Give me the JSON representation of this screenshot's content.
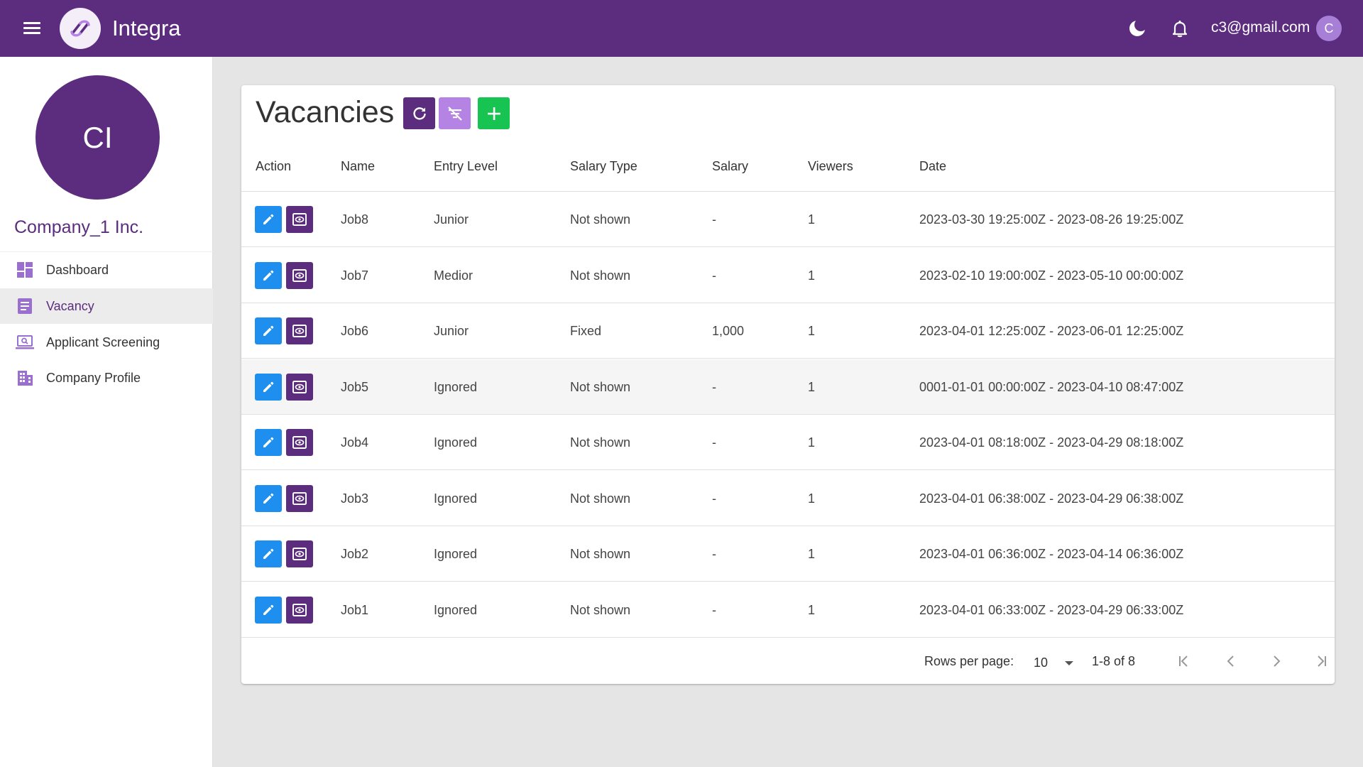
{
  "app": {
    "title": "Integra",
    "logo_icon": "integra-logo-icon",
    "accent": "#5c2d7e"
  },
  "topbar": {
    "user_email": "c3@gmail.com",
    "user_initial": "C"
  },
  "sidebar": {
    "avatar_initials": "CI",
    "company_name": "Company_1 Inc.",
    "items": [
      {
        "label": "Dashboard",
        "icon": "dashboard-icon",
        "active": false
      },
      {
        "label": "Vacancy",
        "icon": "article-icon",
        "active": true
      },
      {
        "label": "Applicant Screening",
        "icon": "laptop-search-icon",
        "active": false
      },
      {
        "label": "Company Profile",
        "icon": "building-icon",
        "active": false
      }
    ]
  },
  "main": {
    "title": "Vacancies",
    "columns": [
      "Action",
      "Name",
      "Entry Level",
      "Salary Type",
      "Salary",
      "Viewers",
      "Date"
    ],
    "rows": [
      {
        "name": "Job8",
        "entry": "Junior",
        "salary_type": "Not shown",
        "salary": "-",
        "viewers": "1",
        "date": "2023-03-30 19:25:00Z - 2023-08-26 19:25:00Z"
      },
      {
        "name": "Job7",
        "entry": "Medior",
        "salary_type": "Not shown",
        "salary": "-",
        "viewers": "1",
        "date": "2023-02-10 19:00:00Z - 2023-05-10 00:00:00Z"
      },
      {
        "name": "Job6",
        "entry": "Junior",
        "salary_type": "Fixed",
        "salary": "1,000",
        "viewers": "1",
        "date": "2023-04-01 12:25:00Z - 2023-06-01 12:25:00Z"
      },
      {
        "name": "Job5",
        "entry": "Ignored",
        "salary_type": "Not shown",
        "salary": "-",
        "viewers": "1",
        "date": "0001-01-01 00:00:00Z - 2023-04-10 08:47:00Z"
      },
      {
        "name": "Job4",
        "entry": "Ignored",
        "salary_type": "Not shown",
        "salary": "-",
        "viewers": "1",
        "date": "2023-04-01 08:18:00Z - 2023-04-29 08:18:00Z"
      },
      {
        "name": "Job3",
        "entry": "Ignored",
        "salary_type": "Not shown",
        "salary": "-",
        "viewers": "1",
        "date": "2023-04-01 06:38:00Z - 2023-04-29 06:38:00Z"
      },
      {
        "name": "Job2",
        "entry": "Ignored",
        "salary_type": "Not shown",
        "salary": "-",
        "viewers": "1",
        "date": "2023-04-01 06:36:00Z - 2023-04-14 06:36:00Z"
      },
      {
        "name": "Job1",
        "entry": "Ignored",
        "salary_type": "Not shown",
        "salary": "-",
        "viewers": "1",
        "date": "2023-04-01 06:33:00Z - 2023-04-29 06:33:00Z"
      }
    ],
    "pagination": {
      "rows_per_page_label": "Rows per page:",
      "rows_per_page": "10",
      "range": "1-8 of 8"
    }
  },
  "colors": {
    "edit_button": "#1f8fef",
    "view_button": "#5c2d7e",
    "add_button": "#17c451",
    "filter_button": "#b583e3"
  }
}
